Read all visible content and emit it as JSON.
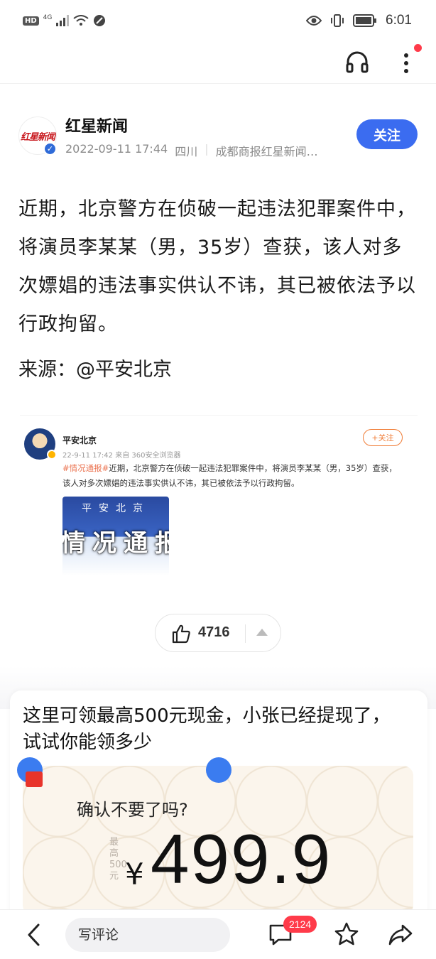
{
  "status_bar": {
    "hd": "HD",
    "network": "4G",
    "time": "6:01"
  },
  "author": {
    "logo_text": "红星新闻",
    "name": "红星新闻",
    "date": "2022-09-11 17:44",
    "location": "四川",
    "source": "成都商报红星新闻…",
    "follow_label": "关注"
  },
  "article": {
    "body": "近期，北京警方在侦破一起违法犯罪案件中，将演员李某某（男，35岁）查获，该人对多次嫖娼的违法事实供认不讳，其已被依法予以行政拘留。",
    "source": "来源：@平安北京"
  },
  "embed": {
    "name": "平安北京",
    "meta": "22-9-11 17:42  来自 360安全浏览器",
    "follow_label": "+关注",
    "tag": "#情况通报#",
    "text": "近期，北京警方在侦破一起违法犯罪案件中，将演员李某某（男，35岁）查获，该人对多次嫖娼的违法事实供认不讳，其已被依法予以行政拘留。",
    "image_top": "平安北京",
    "image_big": "情况通报"
  },
  "likes": {
    "count": "4716"
  },
  "ad": {
    "title": "这里可领最高500元现金，小张已经提现了，试试你能领多少",
    "question": "确认不要了吗?",
    "side_label": "最高500元",
    "currency": "¥",
    "amount": "499.9"
  },
  "bottom_bar": {
    "comment_placeholder": "写评论",
    "comment_count": "2124"
  },
  "colors": {
    "accent": "#3b6cf0",
    "badge": "#ff3b4a",
    "embed_tag": "#eb7350"
  }
}
